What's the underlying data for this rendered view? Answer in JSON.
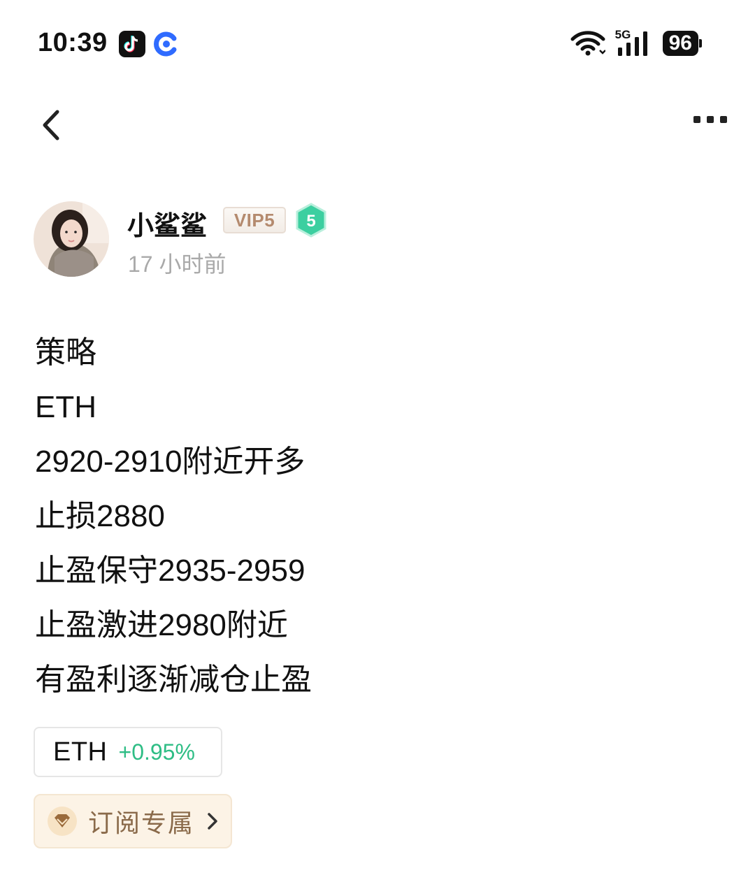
{
  "status_bar": {
    "time": "10:39",
    "network": "5G",
    "battery": "96",
    "icons": [
      "tiktok-icon",
      "c-app-icon",
      "wifi-icon",
      "signal-icon",
      "battery-icon"
    ]
  },
  "nav": {
    "icons": [
      "back-icon",
      "more-icon"
    ]
  },
  "author": {
    "name": "小鲨鲨",
    "vip": "VIP5",
    "level": "5",
    "time_ago": "17 小时前"
  },
  "post": {
    "lines": [
      "策略",
      "ETH",
      "2920-2910附近开多",
      "止损2880",
      "止盈保守2935-2959",
      "止盈激进2980附近",
      "有盈利逐渐减仓止盈"
    ]
  },
  "ticker": {
    "symbol": "ETH",
    "change": "+0.95%"
  },
  "subscribe": {
    "label": "订阅专属"
  },
  "colors": {
    "positive": "#2ebd85",
    "muted": "#a9a9a9",
    "vip": "#b48a6e",
    "level_badge": "#3ccfa0",
    "subscribe_bg": "#fcf3e6",
    "subscribe_text": "#8a6a4a"
  }
}
